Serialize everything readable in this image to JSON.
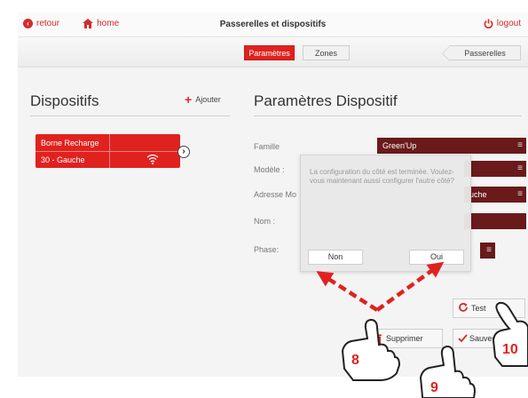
{
  "topbar": {
    "back_label": "retour",
    "home_label": "home",
    "title": "Passerelles et dispositifs",
    "logout_label": "logout"
  },
  "tabs": {
    "params": "Paramètres",
    "zones": "Zones",
    "passerelles": "Passerelles"
  },
  "left": {
    "title": "Dispositifs",
    "add_label": "Ajouter",
    "device": {
      "name": "Borne Recharge",
      "zone": "30 - Gauche"
    }
  },
  "right": {
    "title": "Paramètres Dispositif",
    "fields": {
      "famille_label": "Famille",
      "famille_value": "Green'Up",
      "modele_label": "Modèle :",
      "adresse_label": "Adresse Mo",
      "adresse_value": "uche",
      "nom_label": "Nom :",
      "phase_label": "Phase:"
    }
  },
  "dialog": {
    "message": "La configuration du côté est terminée. Voulez-vous maintenant aussi configurer l'autre côté?",
    "no_label": "Non",
    "yes_label": "Oui"
  },
  "buttons": {
    "test": "Test",
    "supprimer": "Supprimer",
    "sauvegarder": "Sauvega"
  },
  "annotations": {
    "step8": "8",
    "step9": "9",
    "step10": "10",
    "color": "#e0221f"
  },
  "colors": {
    "accent": "#e0221f",
    "field_bg": "#6a1a1a"
  }
}
